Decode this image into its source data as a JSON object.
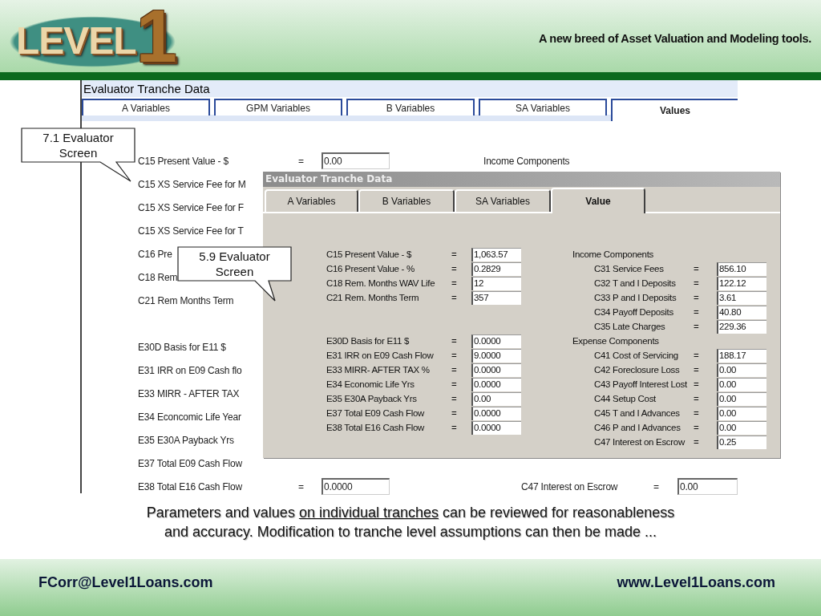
{
  "header": {
    "logo": {
      "word": "LEVEL",
      "numeral": "1"
    },
    "tagline": "A new breed of Asset Valuation and Modeling tools."
  },
  "back_screen": {
    "title": "Evaluator Tranche Data",
    "tabs": [
      {
        "label": "A Variables",
        "selected": false
      },
      {
        "label": "GPM Variables",
        "selected": false
      },
      {
        "label": "B Variables",
        "selected": false
      },
      {
        "label": "SA Variables",
        "selected": false
      },
      {
        "label": "Values",
        "selected": true
      }
    ],
    "upper_fields": [
      {
        "label": "C15 Present Value - $",
        "equals": "=",
        "value": "0.00"
      },
      {
        "label": "C15 XS Service Fee for M"
      },
      {
        "label": "C15 XS Service Fee for F"
      },
      {
        "label": "C15 XS Service Fee for T"
      },
      {
        "label": "C16 Pre"
      },
      {
        "label": "C18 Rem"
      },
      {
        "label": "C21 Rem Months Term"
      }
    ],
    "lower_fields": [
      {
        "label": "E30D Basis for E11 $"
      },
      {
        "label": "E31 IRR on E09 Cash flo"
      },
      {
        "label": "E33 MIRR - AFTER TAX"
      },
      {
        "label": "E34 Econcomic Life Year"
      },
      {
        "label": "E35 E30A Payback Yrs"
      },
      {
        "label": "E37 Total E09 Cash Flow"
      },
      {
        "label": "E38 Total E16 Cash Flow",
        "equals": "=",
        "value": "0.0000"
      }
    ],
    "income_heading": "Income Components",
    "right_field": {
      "label": "C47 Interest on Escrow",
      "equals": "=",
      "value": "0.00"
    }
  },
  "front_dialog": {
    "title": "Evaluator Tranche Data",
    "tabs": [
      {
        "label": "A Variables",
        "selected": false
      },
      {
        "label": "B Variables",
        "selected": false
      },
      {
        "label": "SA Variables",
        "selected": false
      },
      {
        "label": "Value",
        "selected": true
      }
    ],
    "left_groups": [
      {
        "rows": [
          {
            "label": "C15 Present Value - $",
            "equals": "=",
            "value": "1,063.57"
          },
          {
            "label": "C16 Present Value - %",
            "equals": "=",
            "value": "0.2829"
          },
          {
            "label": "C18 Rem. Months WAV Life",
            "equals": "=",
            "value": "12"
          },
          {
            "label": "C21 Rem. Months Term",
            "equals": "=",
            "value": "357"
          }
        ]
      },
      {
        "rows": [
          {
            "label": "E30D Basis for E11 $",
            "equals": "=",
            "value": "0.0000"
          },
          {
            "label": "E31 IRR on E09 Cash Flow",
            "equals": "=",
            "value": "9.0000"
          },
          {
            "label": "E33 MIRR- AFTER TAX %",
            "equals": "=",
            "value": "0.0000"
          },
          {
            "label": "E34 Economic Life Yrs",
            "equals": "=",
            "value": "0.0000"
          },
          {
            "label": "E35 E30A Payback Yrs",
            "equals": "=",
            "value": "0.00"
          },
          {
            "label": "E37 Total E09 Cash Flow",
            "equals": "=",
            "value": "0.0000"
          },
          {
            "label": "E38 Total E16 Cash Flow",
            "equals": "=",
            "value": "0.0000"
          }
        ]
      }
    ],
    "right_sections": [
      {
        "heading": "Income Components",
        "rows": [
          {
            "label": "C31 Service Fees",
            "equals": "=",
            "value": "856.10"
          },
          {
            "label": "C32 T and I Deposits",
            "equals": "=",
            "value": "122.12"
          },
          {
            "label": "C33 P and I Deposits",
            "equals": "=",
            "value": "3.61"
          },
          {
            "label": "C34 Payoff Deposits",
            "equals": "=",
            "value": "40.80"
          },
          {
            "label": "C35 Late Charges",
            "equals": "=",
            "value": "229.36"
          }
        ]
      },
      {
        "heading": "Expense Components",
        "rows": [
          {
            "label": "C41 Cost of Servicing",
            "equals": "=",
            "value": "188.17"
          },
          {
            "label": "C42 Foreclosure Loss",
            "equals": "=",
            "value": "0.00"
          },
          {
            "label": "C43 Payoff Interest Lost",
            "equals": "=",
            "value": "0.00"
          },
          {
            "label": "C44 Setup Cost",
            "equals": "=",
            "value": "0.00"
          },
          {
            "label": "C45 T and I Advances",
            "equals": "=",
            "value": "0.00"
          },
          {
            "label": "C46 P and I Advances",
            "equals": "=",
            "value": "0.00"
          },
          {
            "label": "C47 Interest on Escrow",
            "equals": "=",
            "value": "0.25"
          }
        ]
      }
    ]
  },
  "callouts": [
    {
      "text": "7.1 Evaluator Screen"
    },
    {
      "text": "5.9 Evaluator Screen"
    }
  ],
  "caption": {
    "before": "Parameters and values ",
    "link": "on individual tranches",
    "after": " can be reviewed for reasonableness and accuracy. Modification to tranche level assumptions can then be made ..."
  },
  "footer": {
    "email": "FCorr@Level1Loans.com",
    "website": "www.Level1Loans.com"
  }
}
